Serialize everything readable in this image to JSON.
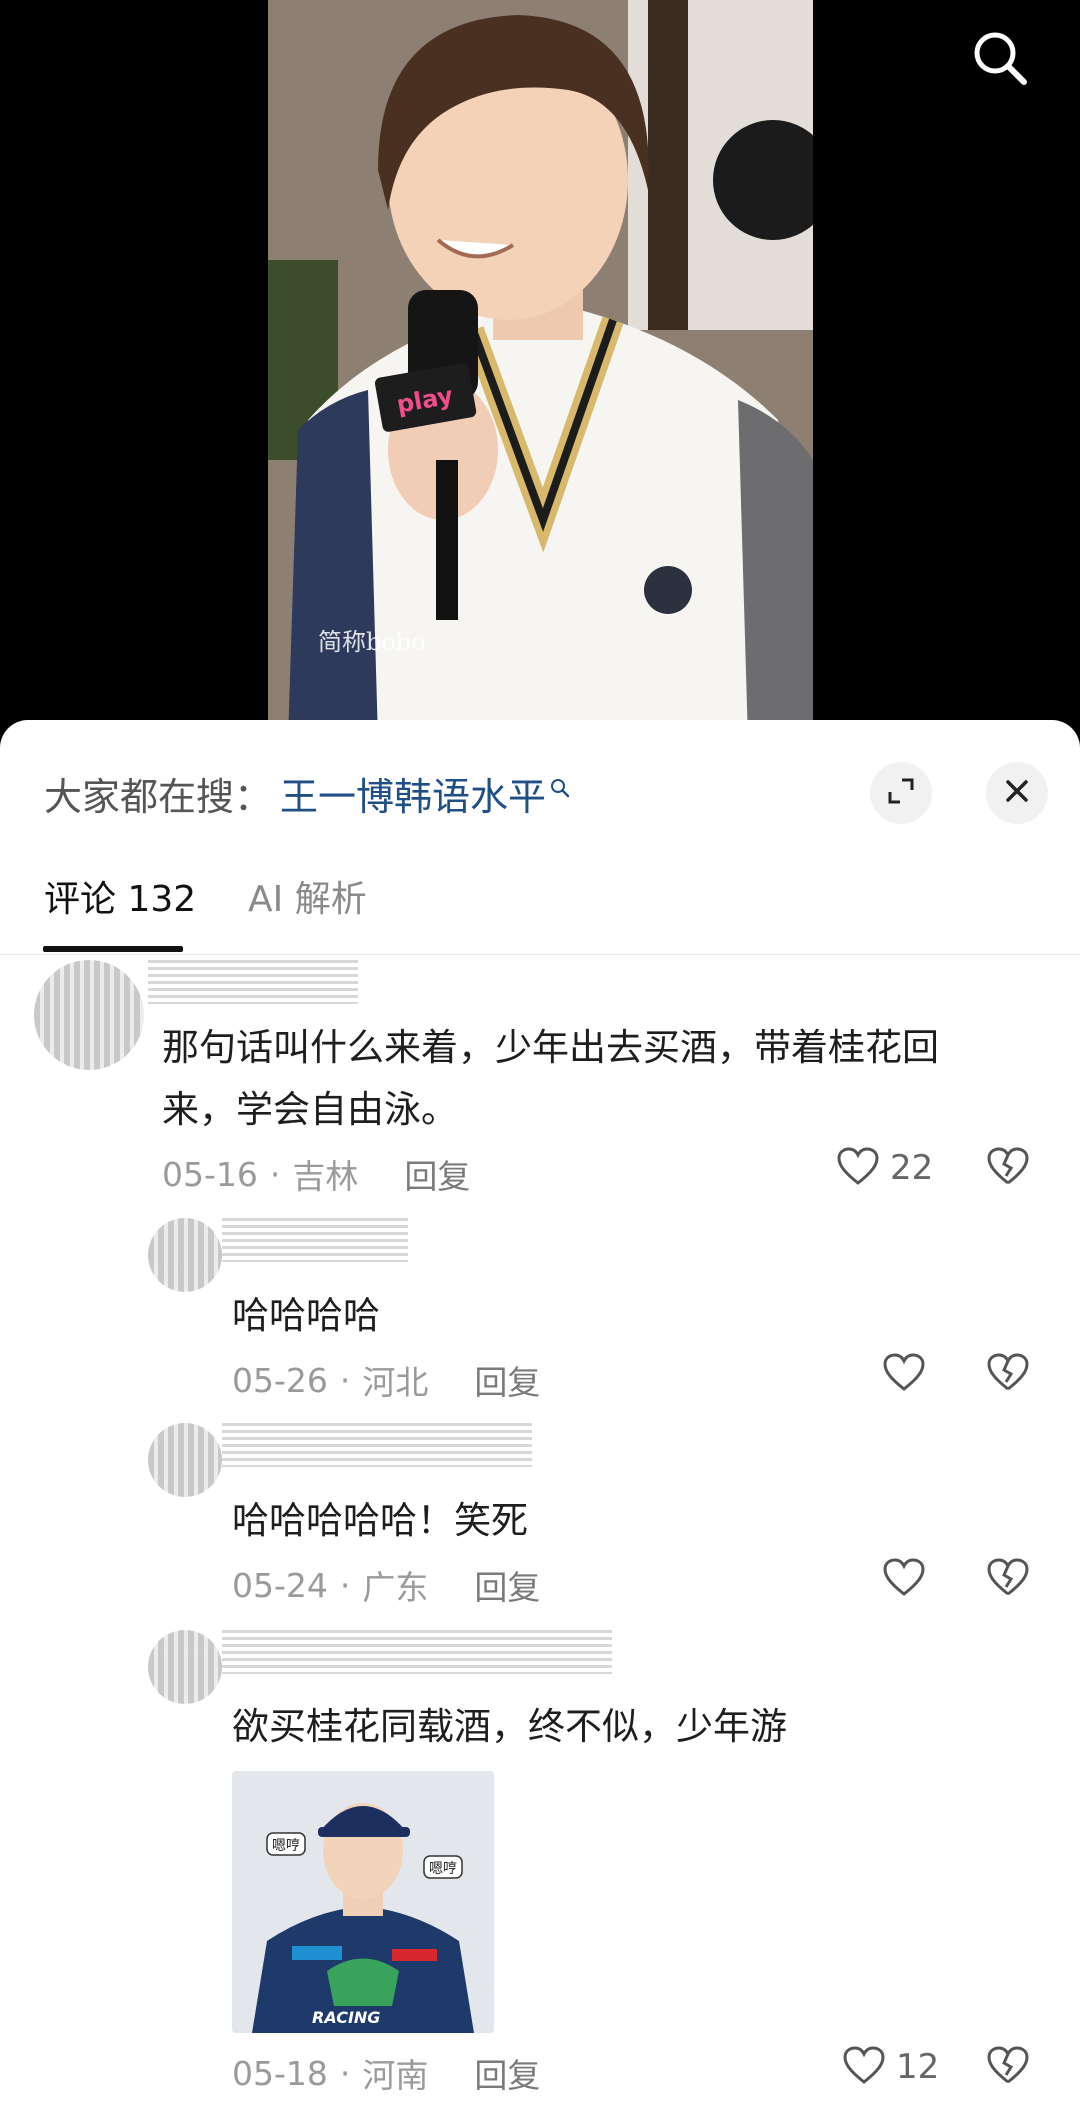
{
  "search_hint": {
    "prefix": "大家都在搜：",
    "keyword": "王一博韩语水平"
  },
  "tabs": [
    {
      "label": "评论 132",
      "active": true
    },
    {
      "label": "AI 解析",
      "active": false
    }
  ],
  "comments": [
    {
      "text_line1": "那句话叫什么来着，少年出去买酒，带着桂花回",
      "text_line2": "来，学会自由泳。",
      "date": "05-16",
      "location": "吉林",
      "reply_label": "回复",
      "likes": "22"
    },
    {
      "text": "哈哈哈哈",
      "date": "05-26",
      "location": "河北",
      "reply_label": "回复",
      "likes": ""
    },
    {
      "text": "哈哈哈哈哈！笑死",
      "date": "05-24",
      "location": "广东",
      "reply_label": "回复",
      "likes": ""
    },
    {
      "text": "欲买桂花同载酒，终不似，少年游",
      "date": "05-18",
      "location": "河南",
      "reply_label": "回复",
      "likes": "12"
    }
  ],
  "video": {
    "mic_label": "play",
    "watermark": "简称bobo"
  },
  "image_stickers": {
    "left": "嗯哼",
    "right": "嗯哼",
    "logo": "RACING"
  },
  "colors": {
    "keyword": "#1f4f86",
    "active_tab_underline": "#111111",
    "meta_gray": "#9a9a9a"
  },
  "icons": [
    "search-icon",
    "expand-icon",
    "close-icon",
    "heart-icon",
    "broken-heart-icon",
    "small-search-icon"
  ]
}
